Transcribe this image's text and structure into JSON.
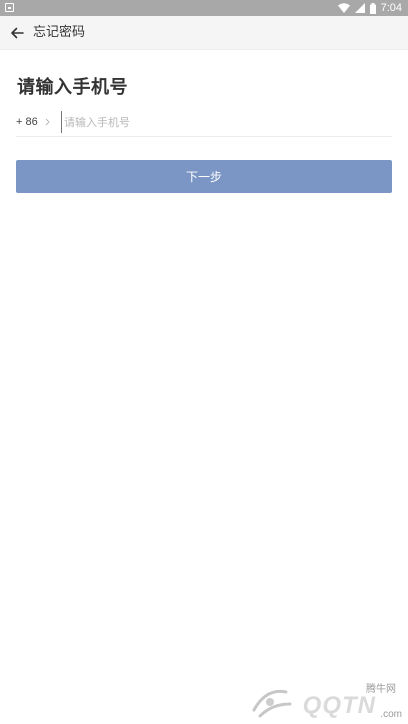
{
  "status_bar": {
    "time": "7:04",
    "icons": [
      "notification-icon",
      "wifi-icon",
      "cell-signal-icon",
      "battery-icon"
    ]
  },
  "toolbar": {
    "title": "忘记密码",
    "back_icon": "arrow-left-icon"
  },
  "main": {
    "heading": "请输入手机号",
    "country_code": "+ 86",
    "phone_value": "",
    "phone_placeholder": "请输入手机号",
    "next_label": "下一步"
  },
  "watermark": {
    "small_text": "腾牛网",
    "brand": "QQTN",
    "suffix": ".com"
  },
  "colors": {
    "status_bar": "#a8a8a8",
    "toolbar_bg": "#f5f5f5",
    "primary_button": "#7b96c4",
    "text_primary": "#333333",
    "placeholder": "#b8b8b8"
  }
}
